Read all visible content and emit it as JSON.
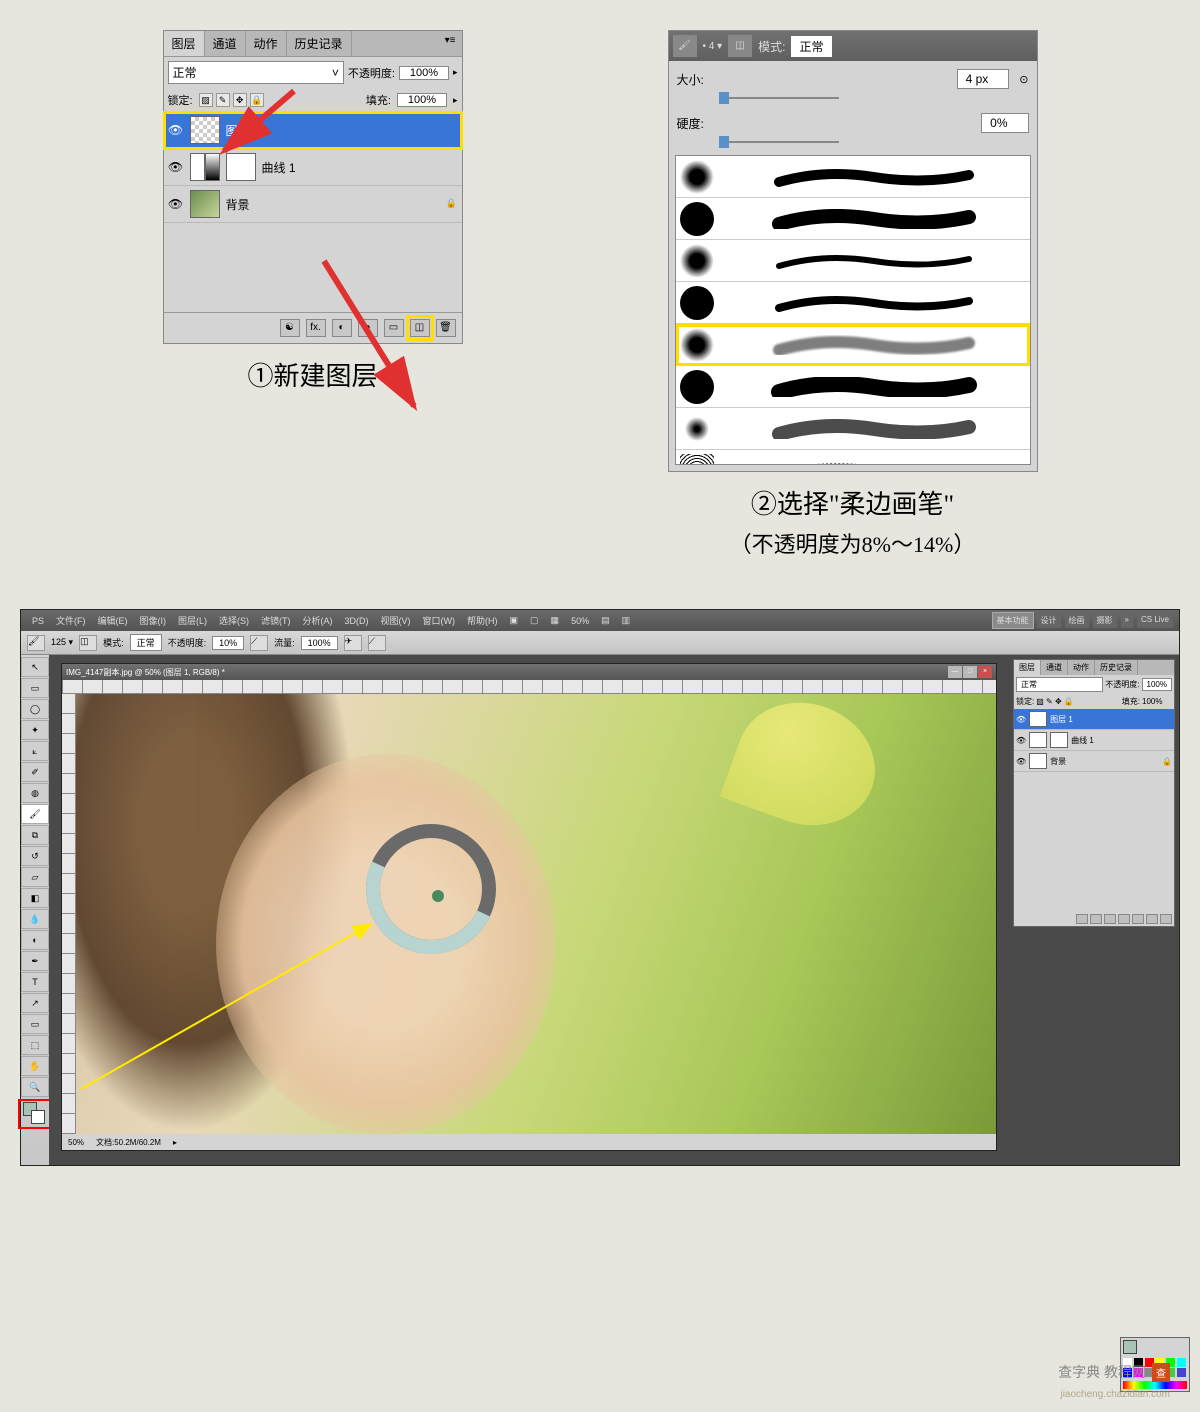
{
  "layers_panel": {
    "tabs": [
      "图层",
      "通道",
      "动作",
      "历史记录"
    ],
    "blend_mode": "正常",
    "opacity_label": "不透明度:",
    "opacity_value": "100%",
    "lock_label": "锁定:",
    "fill_label": "填充:",
    "fill_value": "100%",
    "layers": [
      {
        "name": "图层 1"
      },
      {
        "name": "曲线 1"
      },
      {
        "name": "背景"
      }
    ]
  },
  "caption1": "①新建图层",
  "brush_panel": {
    "mode_label": "模式:",
    "mode_value": "正常",
    "size_label": "大小:",
    "size_value": "4 px",
    "hardness_label": "硬度:",
    "hardness_value": "0%"
  },
  "caption2": "②选择\"柔边画笔\"",
  "caption2_sub": "（不透明度为8%～14%）",
  "ps": {
    "menu": [
      "PS",
      "文件(F)",
      "编辑(E)",
      "图像(I)",
      "图层(L)",
      "选择(S)",
      "滤镜(T)",
      "分析(A)",
      "3D(D)",
      "视图(V)",
      "窗口(W)",
      "帮助(H)"
    ],
    "menu_icons": [
      "■",
      "■",
      "■"
    ],
    "zoom_menu": "50%",
    "right_tabs": [
      "基本功能",
      "设计",
      "绘画",
      "摄影"
    ],
    "cslive": "CS Live",
    "optbar": {
      "brush_size": "125",
      "mode_label": "模式:",
      "mode_value": "正常",
      "opacity_label": "不透明度:",
      "opacity_value": "10%",
      "flow_label": "流量:",
      "flow_value": "100%"
    },
    "doc_title": "IMG_4147副本.jpg @ 50% (图层 1, RGB/8) *",
    "tab_title": "IMG_4147副本.jpg @ 50% (图层 1, RGB/8)",
    "status_zoom": "50%",
    "status_doc": "文档:50.2M/60.2M",
    "mini": {
      "tabs": [
        "图层",
        "通道",
        "动作",
        "历史记录"
      ],
      "blend": "正常",
      "opacity_label": "不透明度:",
      "opacity": "100%",
      "lock_label": "锁定:",
      "fill_label": "填充:",
      "fill": "100%",
      "layers": [
        {
          "name": "图层 1"
        },
        {
          "name": "曲线 1"
        },
        {
          "name": "背景"
        }
      ]
    }
  },
  "watermark": "查字典 教程网",
  "watermark_url": "jiaocheng.chazidian.com"
}
